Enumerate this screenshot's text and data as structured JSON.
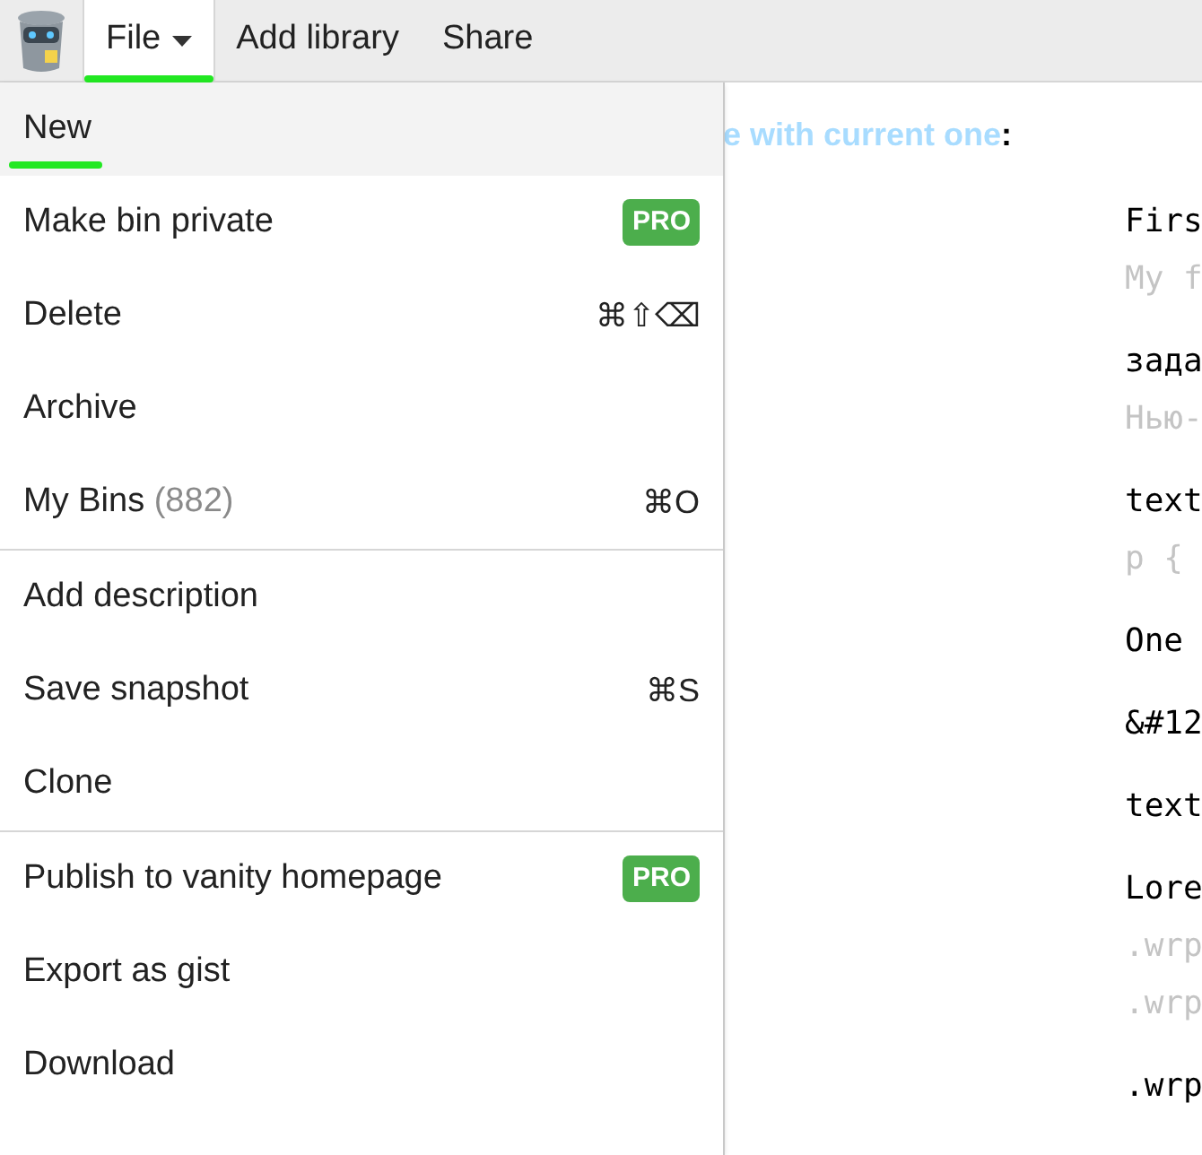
{
  "toolbar": {
    "tabs": [
      {
        "label": "File",
        "caret": true,
        "selected": true,
        "marked": true
      },
      {
        "label": "Add library",
        "caret": false,
        "selected": false,
        "marked": false
      },
      {
        "label": "Share",
        "caret": false,
        "selected": false,
        "marked": false
      }
    ]
  },
  "menu": {
    "sections": [
      {
        "items": [
          {
            "label": "New",
            "selected": true,
            "marked": true
          },
          {
            "label": "Make bin private",
            "badge": "PRO",
            "selected": false,
            "marked": false
          },
          {
            "label": "Delete",
            "shortcut": "⌘⇧⌫",
            "selected": false,
            "marked": false
          },
          {
            "label": "Archive",
            "selected": false,
            "marked": false
          },
          {
            "label": "My Bins",
            "count": "(882)",
            "shortcut": "⌘O",
            "selected": false,
            "marked": false
          }
        ]
      },
      {
        "items": [
          {
            "label": "Add description",
            "selected": false,
            "marked": false
          },
          {
            "label": "Save snapshot",
            "shortcut": "⌘S",
            "selected": false,
            "marked": false
          },
          {
            "label": "Clone",
            "selected": false,
            "marked": false
          }
        ]
      },
      {
        "items": [
          {
            "label": "Publish to vanity homepage",
            "badge": "PRO",
            "selected": false,
            "marked": false
          },
          {
            "label": "Export as gist",
            "selected": false,
            "marked": false
          },
          {
            "label": "Download",
            "selected": false,
            "marked": false
          }
        ]
      }
    ]
  },
  "content": {
    "heading": {
      "link": "e with current one",
      "rest": ":"
    },
    "blocks": [
      {
        "lines": [
          {
            "text": "Firs",
            "dim": false
          },
          {
            "text": "My f",
            "dim": true
          }
        ]
      },
      {
        "lines": [
          {
            "text": "зада",
            "dim": false
          },
          {
            "text": "Нью-",
            "dim": true
          }
        ]
      },
      {
        "lines": [
          {
            "text": "text",
            "dim": false
          },
          {
            "text": "p {",
            "dim": true
          }
        ]
      },
      {
        "lines": [
          {
            "text": "One",
            "dim": false
          }
        ]
      },
      {
        "lines": [
          {
            "text": "&#12",
            "dim": false
          }
        ]
      },
      {
        "lines": [
          {
            "text": "text",
            "dim": false
          }
        ]
      },
      {
        "lines": [
          {
            "text": "Lore",
            "dim": false
          },
          {
            "text": ".wrp",
            "dim": true
          },
          {
            "text": ".wrp",
            "dim": true
          }
        ]
      },
      {
        "lines": [
          {
            "text": ".wrp",
            "dim": false
          }
        ]
      }
    ]
  }
}
